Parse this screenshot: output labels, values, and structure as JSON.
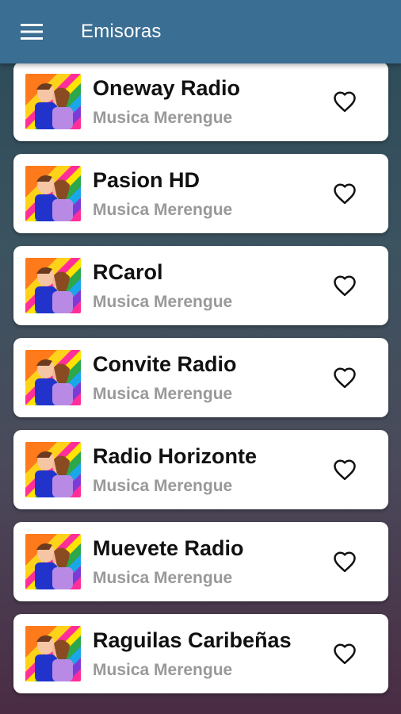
{
  "appbar": {
    "title": "Emisoras",
    "menu_icon": "menu-icon",
    "color": "#3b6e93"
  },
  "stations": [
    {
      "name": "Oneway Radio",
      "genre": "Musica Merengue"
    },
    {
      "name": "Pasion HD",
      "genre": "Musica Merengue"
    },
    {
      "name": "RCarol",
      "genre": "Musica Merengue"
    },
    {
      "name": "Convite Radio",
      "genre": "Musica Merengue"
    },
    {
      "name": "Radio Horizonte",
      "genre": "Musica Merengue"
    },
    {
      "name": "Muevete Radio",
      "genre": "Musica Merengue"
    },
    {
      "name": "Raguilas Caribeñas",
      "genre": "Musica Merengue"
    }
  ],
  "icons": {
    "favorite": "heart-outline-icon",
    "thumbnail": "station-artwork"
  }
}
